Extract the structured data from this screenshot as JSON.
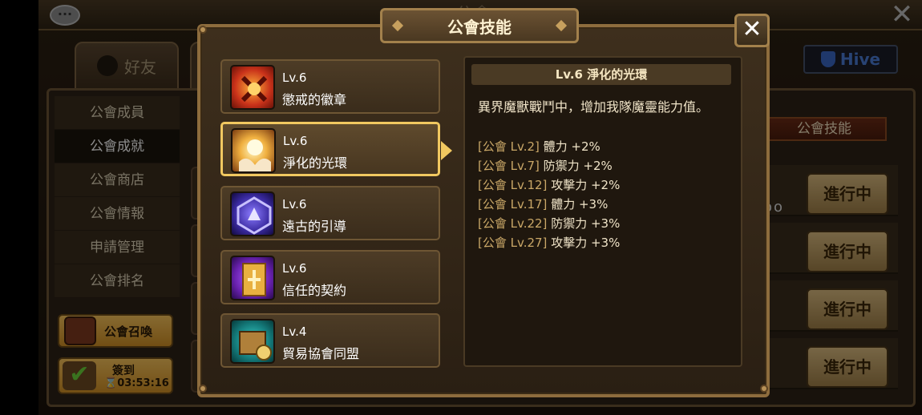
{
  "background": {
    "top_title": "公會",
    "friends_tab": "好友",
    "hive_label": "Hive",
    "menu": [
      "公會成員",
      "公會成就",
      "公會商店",
      "公會情報",
      "申請管理",
      "公會排名"
    ],
    "active_menu_index": 1,
    "summon_label": "公會召喚",
    "checkin_label": "簽到",
    "checkin_timer": "03:53:16",
    "guild_skill_tag": "公會技能",
    "progress_label": "進行中",
    "dots": "oo"
  },
  "modal": {
    "title": "公會技能",
    "close_symbol": "✕",
    "skills": [
      {
        "level": "Lv.6",
        "name": "懲戒的徽章",
        "icon": "crossed-axes-icon",
        "color": "#c9321a"
      },
      {
        "level": "Lv.6",
        "name": "淨化的光環",
        "icon": "glowing-hands-icon",
        "color": "#e8a53a",
        "selected": true
      },
      {
        "level": "Lv.6",
        "name": "遠古的引導",
        "icon": "rune-emblem-icon",
        "color": "#5a3ed0"
      },
      {
        "level": "Lv.6",
        "name": "信任的契約",
        "icon": "contract-scroll-icon",
        "color": "#7a2fc0"
      },
      {
        "level": "Lv.4",
        "name": "貿易協會同盟",
        "icon": "trade-crate-icon",
        "color": "#1d8a8a"
      }
    ],
    "detail": {
      "title": "Lv.6 淨化的光環",
      "description": "異界魔獸戰鬥中，增加我隊魔靈能力值。",
      "bonuses": [
        {
          "req": "[公會 Lv.2]",
          "effect": "體力 +2%"
        },
        {
          "req": "[公會 Lv.7]",
          "effect": "防禦力 +2%"
        },
        {
          "req": "[公會 Lv.12]",
          "effect": "攻擊力 +2%"
        },
        {
          "req": "[公會 Lv.17]",
          "effect": "體力 +3%"
        },
        {
          "req": "[公會 Lv.22]",
          "effect": "防禦力 +3%"
        },
        {
          "req": "[公會 Lv.27]",
          "effect": "攻擊力 +3%"
        }
      ]
    }
  }
}
